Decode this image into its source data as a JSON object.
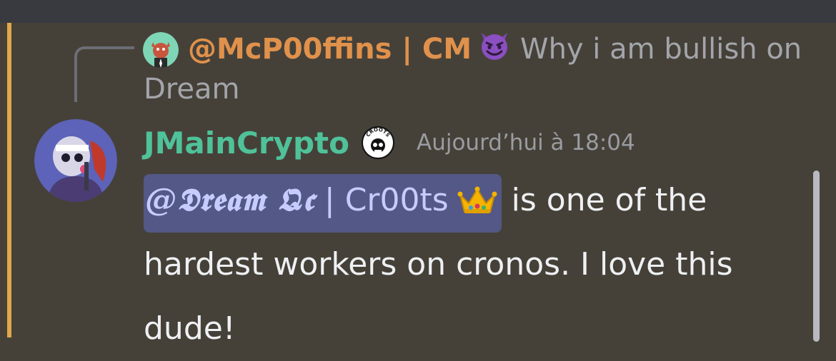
{
  "app": {
    "colors": {
      "background": "#454139",
      "top_bar": "#383a40",
      "accent_bar": "#e0a84b",
      "reply_author": "#e0914b",
      "author": "#4fc29a",
      "mention_bg": "#545886",
      "mention_text": "#c6ccff",
      "text": "#eef0f2",
      "muted": "#a3a5aa"
    }
  },
  "reply": {
    "avatar_icon": "red-devil-avatar",
    "author": "@McP00ffins | CM",
    "author_emoji_icon": "smiling-imp-emoji",
    "text": "Why i am bullish on Dream"
  },
  "message": {
    "avatar_icon": "masked-character-avatar",
    "author": "JMainCrypto",
    "role_badge_icon": "croots-skull-badge",
    "role_badge_label": "CROOTS",
    "timestamp": "Aujourd’hui à 18:04",
    "mention": {
      "fancy_part": "@𝕯𝖗𝖊𝖆𝖒 𝕼𝖈",
      "plain_part": " | Cr00ts",
      "emoji_icon": "crown-emoji"
    },
    "text": " is one of the hardest workers on cronos. I love this dude!"
  }
}
